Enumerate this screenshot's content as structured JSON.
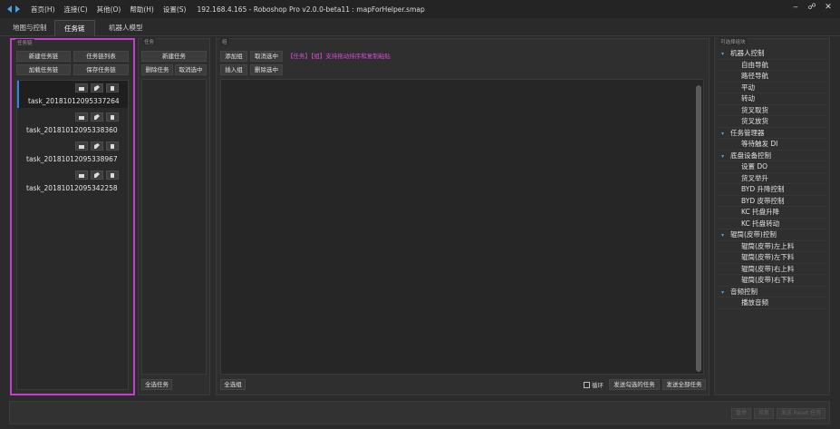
{
  "menu": [
    "首页(H)",
    "连接(C)",
    "其他(O)",
    "帮助(H)",
    "设置(S)"
  ],
  "window_title": "192.168.4.165 - Roboshop Pro v2.0.0-beta11 : mapForHelper.smap",
  "window_controls": {
    "minimize": "‒",
    "maximize": "☍",
    "close": "✕"
  },
  "tabs": [
    {
      "label": "地图与控制",
      "active": false
    },
    {
      "label": "任务链",
      "active": true
    },
    {
      "label": "机器人模型",
      "active": false
    }
  ],
  "chain_panel": {
    "title": "任务链",
    "buttons": {
      "new": "新建任务链",
      "list": "任务链列表",
      "load": "加载任务链",
      "save": "保存任务链"
    },
    "items": [
      {
        "name": "task_20181012095337264",
        "selected": true
      },
      {
        "name": "task_20181012095338360",
        "selected": false
      },
      {
        "name": "task_20181012095338967",
        "selected": false
      },
      {
        "name": "task_20181012095342258",
        "selected": false
      }
    ]
  },
  "task_panel": {
    "title": "任务",
    "buttons": {
      "new": "新建任务",
      "delete": "删除任务",
      "cancel": "取消选中",
      "select_all": "全选任务"
    }
  },
  "group_panel": {
    "title": "组",
    "buttons": {
      "add": "添加组",
      "cancel": "取消选中",
      "insert": "插入组",
      "delete": "删除选中",
      "select_all": "全选组",
      "send_checked": "发送勾选的任务",
      "send_all": "发送全部任务"
    },
    "hint": "【任务】【组】支持拖动排序和复制粘贴",
    "loop_label": "循环",
    "loop_checked": false,
    "hint_color": "#d94ad9"
  },
  "blocks_panel": {
    "title": "可选择组块",
    "tree": [
      {
        "label": "机器人控制",
        "children": [
          "自由导航",
          "路径导航",
          "平动",
          "转动",
          "货叉取货",
          "货叉放货"
        ]
      },
      {
        "label": "任务管理器",
        "children": [
          "等待触发 DI"
        ]
      },
      {
        "label": "底盘设备控制",
        "children": [
          "设置 DO",
          "货叉举升",
          "BYD 升降控制",
          "BYD 皮带控制",
          "KC 托盘升降",
          "KC 托盘转动"
        ]
      },
      {
        "label": "辊筒(皮带)控制",
        "children": [
          "辊筒(皮带)左上料",
          "辊筒(皮带)左下料",
          "辊筒(皮带)右上料",
          "辊筒(皮带)右下料"
        ]
      },
      {
        "label": "音频控制",
        "children": [
          "播放音频"
        ]
      }
    ]
  },
  "footer": {
    "buttons": [
      "暂停",
      "恢复",
      "发送 Reset 任务"
    ]
  },
  "colors": {
    "highlight_border": "#c83ccf",
    "accent": "#2e86de",
    "caret": "#4aa3df"
  }
}
